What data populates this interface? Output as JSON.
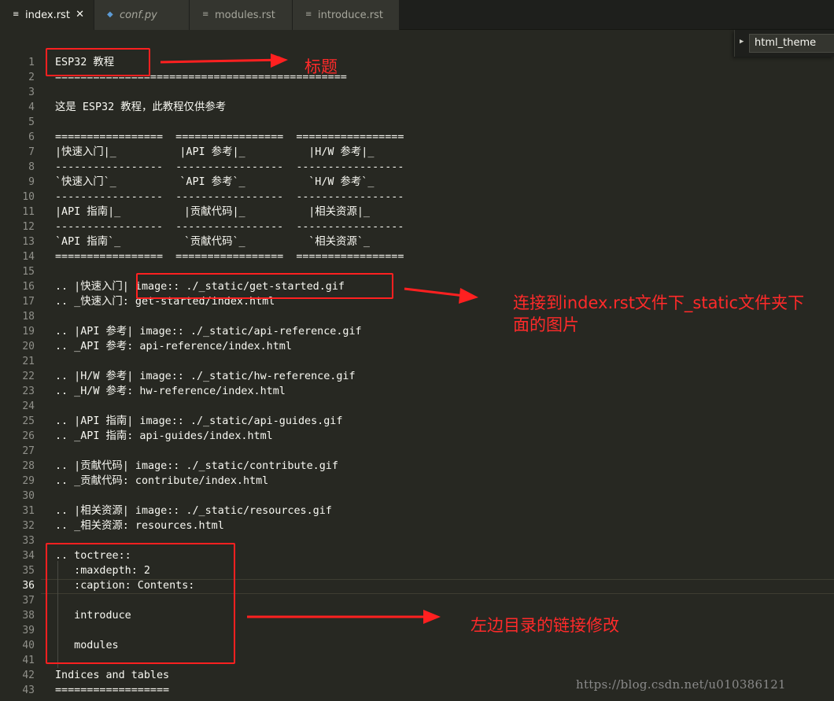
{
  "tabs": [
    {
      "label": "index.rst",
      "icon": "file-text-icon",
      "active": true,
      "close": "✕"
    },
    {
      "label": "conf.py",
      "icon": "python-icon",
      "active": false
    },
    {
      "label": "modules.rst",
      "icon": "file-text-icon",
      "active": false
    },
    {
      "label": "introduce.rst",
      "icon": "file-text-icon",
      "active": false
    }
  ],
  "widget": {
    "label": "html_theme"
  },
  "current_line": 36,
  "lines": [
    {
      "n": "1",
      "text": "ESP32 教程"
    },
    {
      "n": "2",
      "text": "=============================================="
    },
    {
      "n": "3",
      "text": ""
    },
    {
      "n": "4",
      "text": "这是 ESP32 教程，此教程仅供参考"
    },
    {
      "n": "5",
      "text": ""
    },
    {
      "n": "6",
      "text": "=================  =================  ================="
    },
    {
      "n": "7",
      "text": "|快速入门|_          |API 参考|_          |H/W 参考|_"
    },
    {
      "n": "8",
      "text": "-----------------  -----------------  -----------------"
    },
    {
      "n": "9",
      "text": "`快速入门`_          `API 参考`_          `H/W 参考`_"
    },
    {
      "n": "10",
      "text": "-----------------  -----------------  -----------------"
    },
    {
      "n": "11",
      "text": "|API 指南|_          |贡献代码|_          |相关资源|_"
    },
    {
      "n": "12",
      "text": "-----------------  -----------------  -----------------"
    },
    {
      "n": "13",
      "text": "`API 指南`_          `贡献代码`_          `相关资源`_"
    },
    {
      "n": "14",
      "text": "=================  =================  ================="
    },
    {
      "n": "15",
      "text": ""
    },
    {
      "n": "16",
      "text": ".. |快速入门| image:: ./_static/get-started.gif"
    },
    {
      "n": "17",
      "text": ".. _快速入门: get-started/index.html"
    },
    {
      "n": "18",
      "text": ""
    },
    {
      "n": "19",
      "text": ".. |API 参考| image:: ./_static/api-reference.gif"
    },
    {
      "n": "20",
      "text": ".. _API 参考: api-reference/index.html"
    },
    {
      "n": "21",
      "text": ""
    },
    {
      "n": "22",
      "text": ".. |H/W 参考| image:: ./_static/hw-reference.gif"
    },
    {
      "n": "23",
      "text": ".. _H/W 参考: hw-reference/index.html"
    },
    {
      "n": "24",
      "text": ""
    },
    {
      "n": "25",
      "text": ".. |API 指南| image:: ./_static/api-guides.gif"
    },
    {
      "n": "26",
      "text": ".. _API 指南: api-guides/index.html"
    },
    {
      "n": "27",
      "text": ""
    },
    {
      "n": "28",
      "text": ".. |贡献代码| image:: ./_static/contribute.gif"
    },
    {
      "n": "29",
      "text": ".. _贡献代码: contribute/index.html"
    },
    {
      "n": "30",
      "text": ""
    },
    {
      "n": "31",
      "text": ".. |相关资源| image:: ./_static/resources.gif"
    },
    {
      "n": "32",
      "text": ".. _相关资源: resources.html"
    },
    {
      "n": "33",
      "text": ""
    },
    {
      "n": "34",
      "text": ".. toctree::"
    },
    {
      "n": "35",
      "text": "   :maxdepth: 2"
    },
    {
      "n": "36",
      "text": "   :caption: Contents:"
    },
    {
      "n": "37",
      "text": ""
    },
    {
      "n": "38",
      "text": "   introduce"
    },
    {
      "n": "39",
      "text": ""
    },
    {
      "n": "40",
      "text": "   modules"
    },
    {
      "n": "41",
      "text": ""
    },
    {
      "n": "42",
      "text": "Indices and tables"
    },
    {
      "n": "43",
      "text": "=================="
    }
  ],
  "annotations": {
    "title_note": "标题",
    "image_note": "连接到index.rst文件下_static文件夹下\n面的图片",
    "toc_note": "左边目录的链接修改",
    "accent_color": "#ff2020"
  },
  "watermark": "https://blog.csdn.net/u010386121"
}
